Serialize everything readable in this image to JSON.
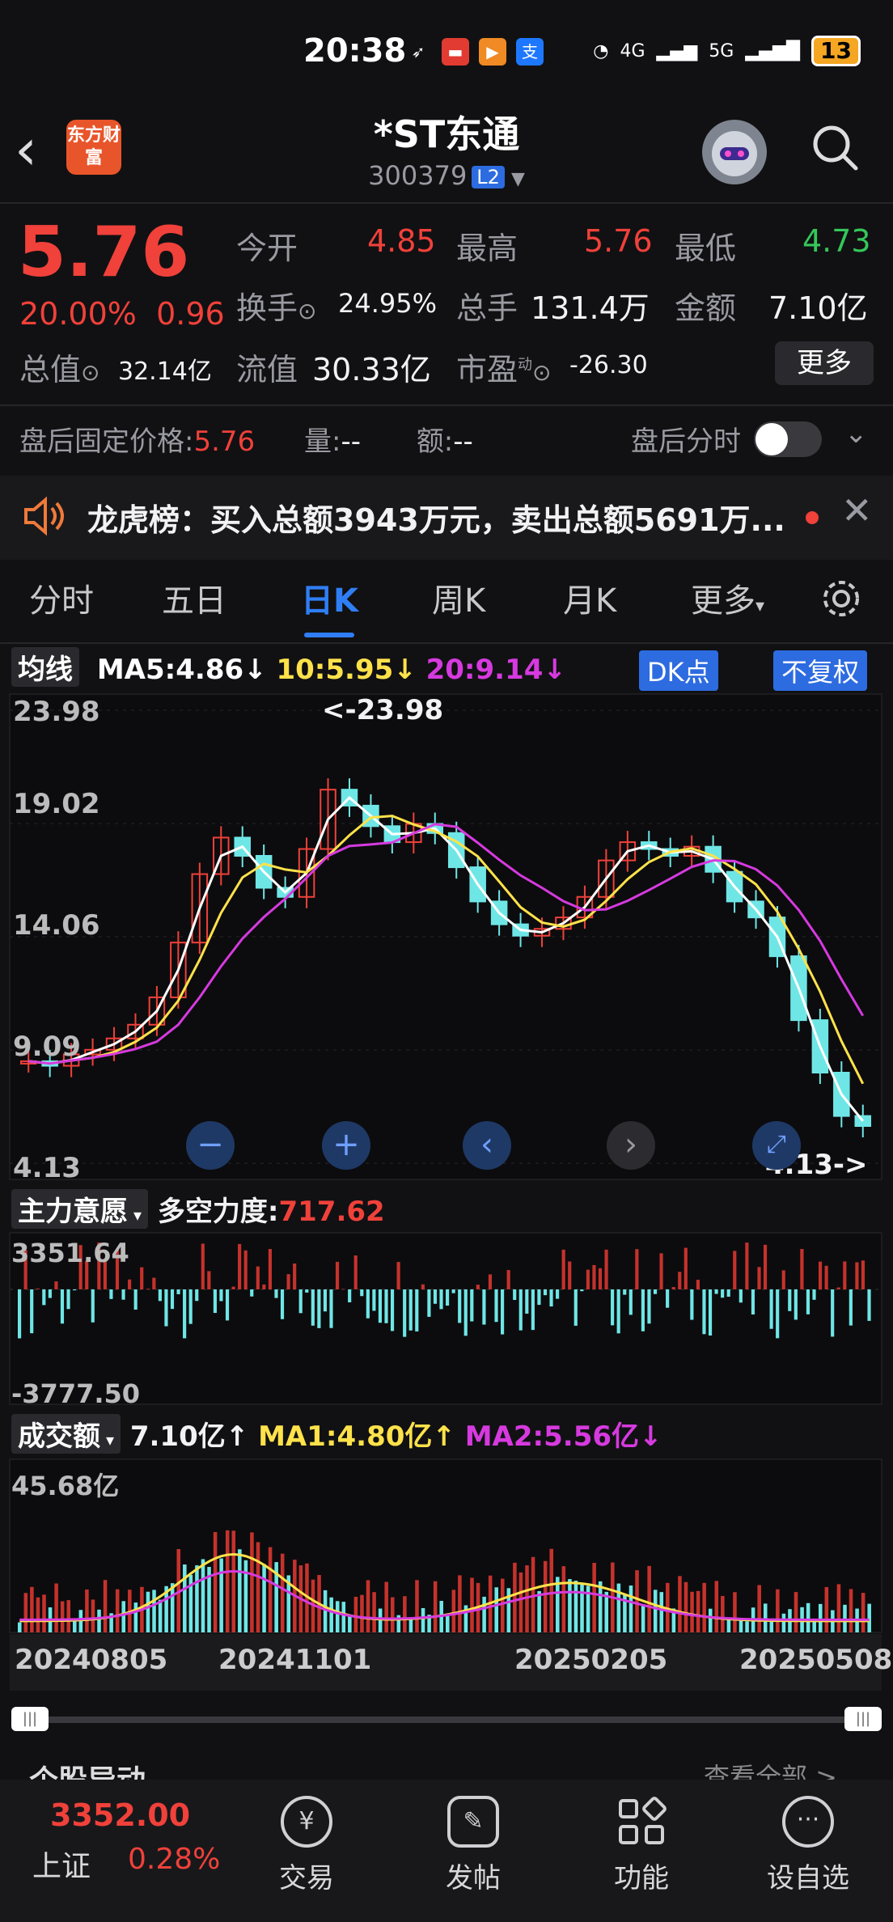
{
  "status_bar": {
    "time": "20:38",
    "battery": "13",
    "net1": "4G",
    "net2": "5G"
  },
  "header": {
    "stock_name": "*ST东通",
    "stock_code": "300379",
    "level": "L2",
    "logo_text": "东方财富"
  },
  "quote": {
    "price": "5.76",
    "change_pct": "20.00%",
    "change_abs": "0.96",
    "open_label": "今开",
    "open": "4.85",
    "high_label": "最高",
    "high": "5.76",
    "low_label": "最低",
    "low": "4.73",
    "turnover_label": "换手",
    "turnover": "24.95%",
    "volume_label": "总手",
    "volume": "131.4万",
    "amount_label": "金额",
    "amount": "7.10亿",
    "mktcap_label": "总值",
    "mktcap": "32.14亿",
    "float_label": "流值",
    "float": "30.33亿",
    "pe_label": "市盈",
    "pe_sup": "动",
    "pe": "-26.30",
    "more_label": "更多"
  },
  "after_hours": {
    "price_label": "盘后固定价格:",
    "price": "5.76",
    "vol_label": "量:",
    "vol": "--",
    "amt_label": "额:",
    "amt": "--",
    "timeshare_label": "盘后分时"
  },
  "dragon_tiger": {
    "text": "龙虎榜：买入总额3943万元，卖出总额5691万..."
  },
  "tabs": [
    "分时",
    "五日",
    "日K",
    "周K",
    "月K",
    "更多"
  ],
  "active_tab": "日K",
  "ma": {
    "label": "均线",
    "ma5": "MA5:4.86↓",
    "ma10": "10:5.95↓",
    "ma20": "20:9.14↓",
    "dk_label": "DK点",
    "adj_label": "不复权"
  },
  "kchart": {
    "y_ticks": [
      "23.98",
      "19.02",
      "14.06",
      "9.09",
      "4.13"
    ],
    "max_note": "<-23.98",
    "min_note": "4.13->"
  },
  "force": {
    "label": "主力意愿",
    "name": "多空力度:",
    "value": "717.62",
    "top": "3351.64",
    "bottom": "-3777.50"
  },
  "vol_panel": {
    "label": "成交额",
    "value": "7.10亿↑",
    "ma1": "MA1:4.80亿↑",
    "ma2": "MA2:5.56亿↓",
    "top": "45.68亿",
    "dates": [
      "20240805",
      "20241101",
      "20250205",
      "20250508"
    ]
  },
  "partial_section": {
    "title": "个股异动",
    "link": "查看全部 >"
  },
  "bottom_nav": {
    "index_price": "3352.00",
    "index_name": "上证",
    "index_change": "0.28%",
    "items": [
      "交易",
      "发帖",
      "功能",
      "设自选"
    ]
  },
  "colors": {
    "red": "#f0413a",
    "green": "#35c75a",
    "cyan": "#6fe6e6",
    "yellow": "#ffe24a",
    "magenta": "#d63adf",
    "blue": "#2f7ef5"
  },
  "chart_data": {
    "type": "candlestick",
    "description_axis": "daily",
    "x_labels": [
      "20240805",
      "20241101",
      "20250205",
      "20250508"
    ],
    "ylim": [
      4.13,
      23.98
    ],
    "ma_series": [
      {
        "name": "MA5",
        "last": 4.86
      },
      {
        "name": "MA10",
        "last": 5.95
      },
      {
        "name": "MA20",
        "last": 9.14
      }
    ],
    "approx_close": [
      8.6,
      8.4,
      8.9,
      9.1,
      9.6,
      10.2,
      11.4,
      13.8,
      16.8,
      18.4,
      17.6,
      16.2,
      15.8,
      17.9,
      20.5,
      19.8,
      18.9,
      18.2,
      19.0,
      18.6,
      17.1,
      15.6,
      14.6,
      14.1,
      14.4,
      14.9,
      15.8,
      17.4,
      18.2,
      17.9,
      17.6,
      18.0,
      16.9,
      15.6,
      14.9,
      13.2,
      10.4,
      8.1,
      6.2,
      5.76
    ],
    "indicator_last": 717.62,
    "indicator_range": [
      -3777.5,
      3351.64
    ],
    "volume_last_yi": 7.1,
    "volume_max_yi": 45.68
  }
}
